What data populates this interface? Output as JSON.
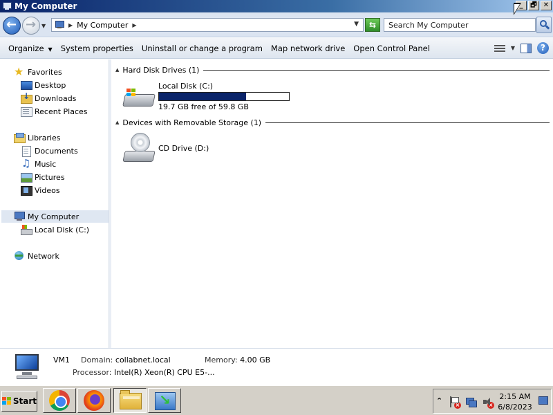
{
  "window": {
    "title": "My Computer",
    "controls": {
      "minimize": "_",
      "restore": "🗗",
      "close": "✕"
    }
  },
  "address_bar": {
    "path": "My Computer",
    "search_placeholder": "Search My Computer"
  },
  "command_bar": {
    "items": [
      "Organize",
      "System properties",
      "Uninstall or change a program",
      "Map network drive",
      "Open Control Panel"
    ]
  },
  "sidebar": {
    "favorites": {
      "label": "Favorites",
      "items": [
        "Desktop",
        "Downloads",
        "Recent Places"
      ]
    },
    "libraries": {
      "label": "Libraries",
      "items": [
        "Documents",
        "Music",
        "Pictures",
        "Videos"
      ]
    },
    "computer": {
      "label": "My Computer",
      "items": [
        "Local Disk (C:)"
      ]
    },
    "network": {
      "label": "Network"
    }
  },
  "main": {
    "groups": [
      {
        "label": "Hard Disk Drives (1)",
        "drives": [
          {
            "name": "Local Disk (C:)",
            "free_text": "19.7 GB free of 59.8 GB",
            "used_fraction": 0.67,
            "icon": "hard-disk-icon"
          }
        ]
      },
      {
        "label": "Devices with Removable Storage (1)",
        "drives": [
          {
            "name": "CD Drive (D:)",
            "icon": "cd-drive-icon"
          }
        ]
      }
    ]
  },
  "details": {
    "computer_name": "VM1",
    "domain_label": "Domain:",
    "domain_value": "collabnet.local",
    "memory_label": "Memory:",
    "memory_value": "4.00 GB",
    "processor_label": "Processor:",
    "processor_value": "Intel(R) Xeon(R) CPU E5-..."
  },
  "taskbar": {
    "start_label": "Start",
    "apps": [
      "chrome-icon",
      "firefox-icon",
      "explorer-icon",
      "download-icon"
    ],
    "clock_time": "2:15 AM",
    "clock_date": "6/8/2023"
  },
  "colors": {
    "accent": "#0a246a",
    "selection": "#dfe7f2"
  }
}
